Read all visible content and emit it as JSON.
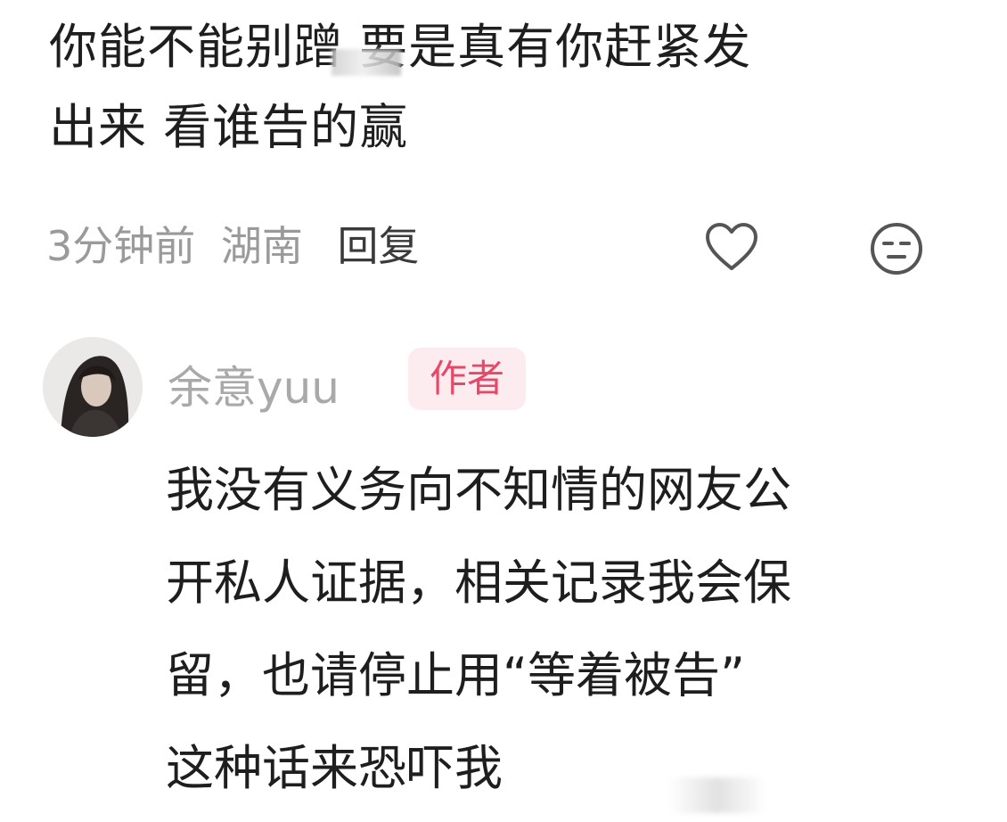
{
  "comment": {
    "lines": [
      "你能不能别蹭 要是真有你赶紧发",
      "出来 看谁告的赢"
    ],
    "time": "3分钟前",
    "location": "湖南",
    "reply_label": "回复",
    "like_icon": "heart-outline-icon",
    "dislike_icon": "unamused-face-icon"
  },
  "author_reply": {
    "author_name": "余意yuu",
    "badge": "作者",
    "lines": [
      "我没有义务向不知情的网友公",
      "开私人证据，相关记录我会保",
      "留，也请停止用“等着被告”",
      "这种话来恐吓我"
    ]
  },
  "colors": {
    "text_primary": "#1e1e1e",
    "text_meta": "#9a9a9a",
    "badge_text": "#e84868",
    "badge_bg": "#fdecef"
  }
}
